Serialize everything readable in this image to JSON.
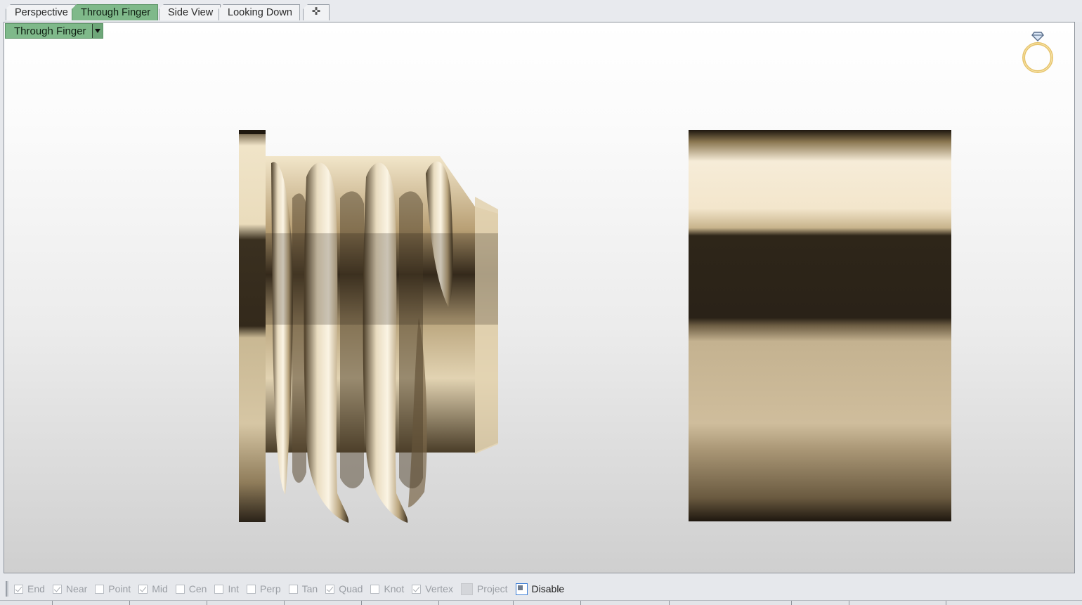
{
  "tabs": [
    {
      "label": "Perspective",
      "active": false
    },
    {
      "label": "Through Finger",
      "active": true
    },
    {
      "label": "Side View",
      "active": false
    },
    {
      "label": "Looking Down",
      "active": false
    }
  ],
  "add_tab_icon": "plus-icon",
  "viewport": {
    "title": "Through Finger",
    "dropdown_icon": "caret-down-icon",
    "corner_icon": "ring-with-diamond-icon"
  },
  "osnap": [
    {
      "label": "End",
      "checked": true
    },
    {
      "label": "Near",
      "checked": true
    },
    {
      "label": "Point",
      "checked": false
    },
    {
      "label": "Mid",
      "checked": true
    },
    {
      "label": "Cen",
      "checked": false
    },
    {
      "label": "Int",
      "checked": false
    },
    {
      "label": "Perp",
      "checked": false
    },
    {
      "label": "Tan",
      "checked": false
    },
    {
      "label": "Quad",
      "checked": true
    },
    {
      "label": "Knot",
      "checked": false
    },
    {
      "label": "Vertex",
      "checked": true
    },
    {
      "label": "Project",
      "checked": false,
      "state": "grey"
    },
    {
      "label": "Disable",
      "checked": false,
      "state": "filled"
    }
  ],
  "colors": {
    "active_tab": "#7fb98a",
    "metal_light": "#f4ead6",
    "metal_mid": "#c9b48c",
    "metal_dark": "#2a2218"
  }
}
